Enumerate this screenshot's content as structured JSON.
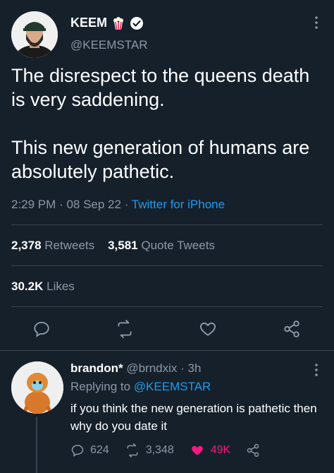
{
  "user": {
    "name": "KEEM",
    "handle": "@KEEMSTAR"
  },
  "tweet": {
    "text_lines": [
      "The disrespect to the queens death is very saddening.",
      "This new generation of humans are absolutely pathetic."
    ],
    "time": "2:29 PM",
    "date": "08 Sep 22",
    "source": "Twitter for iPhone",
    "separator": "·"
  },
  "stats": {
    "retweets_count": "2,378",
    "retweets_label": "Retweets",
    "quotes_count": "3,581",
    "quotes_label": "Quote Tweets",
    "likes_count": "30.2K",
    "likes_label": "Likes"
  },
  "reply": {
    "name": "brandon*",
    "handle": "@brndxix",
    "time": "· 3h",
    "replying_prefix": "Replying to",
    "replying_to": "@KEEMSTAR",
    "text": "if you think the new generation is pathetic then why do you date it",
    "reply_count": "624",
    "retweet_count": "3,348",
    "like_count": "49K"
  },
  "icons": {
    "popcorn": "popcorn-icon",
    "verified": "verified-badge-icon",
    "more": "more-icon",
    "reply": "reply-icon",
    "retweet": "retweet-icon",
    "like": "heart-icon",
    "share": "share-icon"
  },
  "colors": {
    "background": "#15202b",
    "text": "#ffffff",
    "muted": "#8b98a5",
    "link": "#1d9bf0",
    "like_active": "#f91880",
    "divider": "#38444d"
  }
}
